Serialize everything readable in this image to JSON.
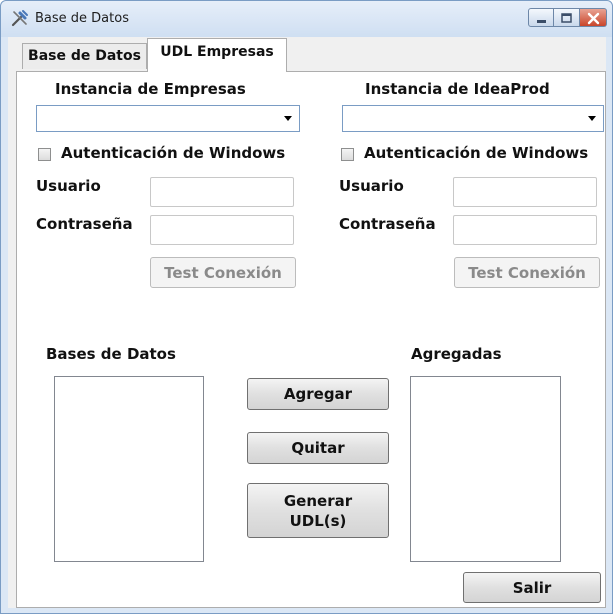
{
  "window": {
    "title": "Base de Datos"
  },
  "tabs": [
    {
      "label": "Base de Datos"
    },
    {
      "label": "UDL Empresas"
    }
  ],
  "left": {
    "instance_label": "Instancia de Empresas",
    "instance_value": "",
    "windows_auth": {
      "label": "Autenticación de Windows",
      "checked": false
    },
    "user_label": "Usuario",
    "user_value": "",
    "password_label": "Contraseña",
    "password_value": "",
    "test_button": "Test Conexión"
  },
  "right": {
    "instance_label": "Instancia de IdeaProd",
    "instance_value": "",
    "windows_auth": {
      "label": "Autenticación de Windows",
      "checked": false
    },
    "user_label": "Usuario",
    "user_value": "",
    "password_label": "Contraseña",
    "password_value": "",
    "test_button": "Test Conexión"
  },
  "databases": {
    "label": "Bases de  Datos",
    "items": []
  },
  "added": {
    "label": "Agregadas",
    "items": []
  },
  "buttons": {
    "add": "Agregar",
    "remove": "Quitar",
    "generate_line1": "Generar",
    "generate_line2": "UDL(s)",
    "exit": "Salir"
  }
}
